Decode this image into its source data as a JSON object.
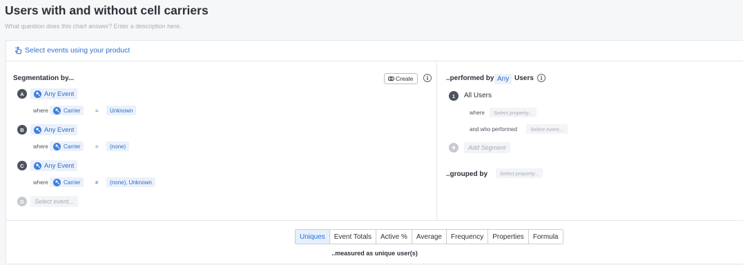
{
  "header": {
    "title": "Users with and without cell carriers",
    "description_placeholder": "What question does this chart answer? Enter a description here."
  },
  "top_bar": {
    "select_events_label": "Select events using your product"
  },
  "segmentation": {
    "heading": "Segmentation by...",
    "create_label": "Create",
    "events": [
      {
        "letter": "A",
        "event": "Any Event",
        "where": "where",
        "property": "Carrier",
        "operator": "=",
        "value": "Unknown"
      },
      {
        "letter": "B",
        "event": "Any Event",
        "where": "where",
        "property": "Carrier",
        "operator": "=",
        "value": "(none)"
      },
      {
        "letter": "C",
        "event": "Any Event",
        "where": "where",
        "property": "Carrier",
        "operator": "≠",
        "value": "(none), Unknown"
      }
    ],
    "next_letter": "D",
    "select_event_placeholder": "Select event..."
  },
  "performed_by": {
    "heading_prefix": "..performed by",
    "any_label": "Any",
    "users_label": "Users",
    "segment_number": "1",
    "segment_name": "All Users",
    "where_label": "where",
    "select_property_placeholder": "Select property...",
    "and_who_performed_label": "and who performed",
    "select_event_placeholder": "Select event...",
    "add_segment_label": "Add Segment",
    "grouped_by_label": "..grouped by",
    "grouped_select_placeholder": "Select property..."
  },
  "measure": {
    "tabs": [
      "Uniques",
      "Event Totals",
      "Active %",
      "Average",
      "Frequency",
      "Properties",
      "Formula"
    ],
    "active_tab": "Uniques",
    "measured_as": "..measured as unique user(s)"
  },
  "colors": {
    "accent": "#2a6fd4",
    "chip_bg": "#ebf1fa",
    "badge_dark": "#4c5260"
  }
}
